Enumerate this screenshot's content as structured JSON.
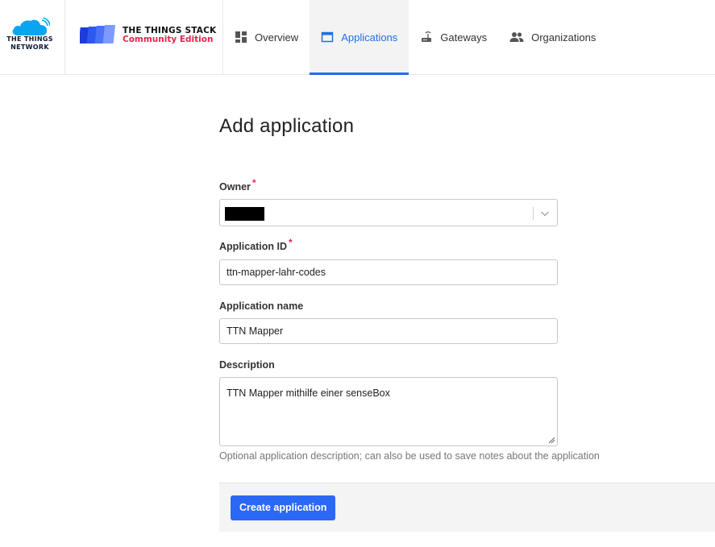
{
  "brand": {
    "ttn_line1": "THE THINGS",
    "ttn_line2": "NETWORK",
    "tts_title": "THE THINGS STACK",
    "tts_subtitle": "Community Edition"
  },
  "nav": {
    "overview": "Overview",
    "applications": "Applications",
    "gateways": "Gateways",
    "organizations": "Organizations",
    "active": "applications"
  },
  "page": {
    "title": "Add application"
  },
  "form": {
    "owner": {
      "label": "Owner",
      "required_mark": "*"
    },
    "application_id": {
      "label": "Application ID",
      "required_mark": "*",
      "value": "ttn-mapper-lahr-codes"
    },
    "application_name": {
      "label": "Application name",
      "value": "TTN Mapper"
    },
    "description": {
      "label": "Description",
      "value": "TTN Mapper mithilfe einer senseBox",
      "help": "Optional application description; can also be used to save notes about the application"
    },
    "submit_label": "Create application"
  },
  "colors": {
    "accent": "#1f6fe5",
    "button": "#2a68f5",
    "required": "#e6244a",
    "brand_red": "#e6244a"
  }
}
